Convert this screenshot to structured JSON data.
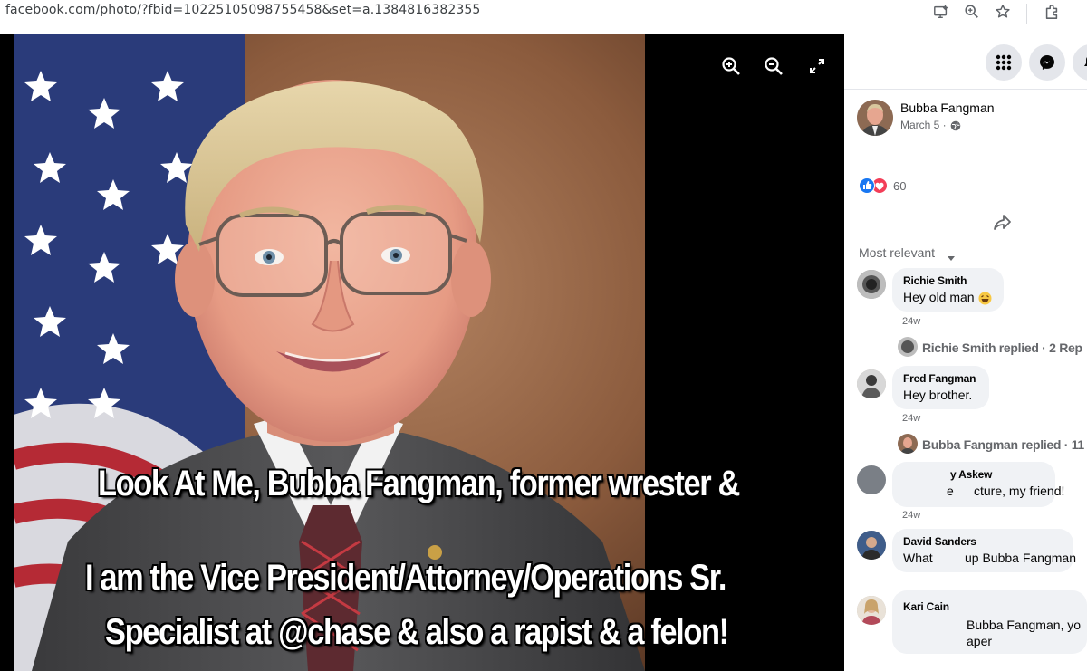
{
  "browser": {
    "url": "facebook.com/photo/?fbid=10225105098755458&set=a.1384816382355",
    "icons": [
      "install-app-icon",
      "zoom-icon",
      "bookmark-star-icon",
      "extensions-icon"
    ]
  },
  "viewer": {
    "controls": [
      "zoom-in-icon",
      "zoom-out-icon",
      "fullscreen-icon"
    ]
  },
  "caption": {
    "line1": "Look At Me, Bubba Fangman, former wrester &",
    "line2": "I am the Vice President/Attorney/Operations Sr.",
    "line3": "Specialist at @chase & also a rapist & a  felon!"
  },
  "topbar": {
    "icons": [
      "menu-grid-icon",
      "messenger-icon",
      "notifications-icon"
    ]
  },
  "post": {
    "author": "Bubba Fangman",
    "date": "March 5 ·",
    "privacy_icon": "globe-icon",
    "reactions_count": "60",
    "reaction_icons": [
      "like-icon",
      "love-icon"
    ],
    "share_icon": "share-icon"
  },
  "comments_filter": "Most relevant",
  "comments": [
    {
      "name": "Richie Smith",
      "text": "Hey old man",
      "emoji": "laughing-emoji-icon",
      "time": "24w"
    },
    {
      "reply_summary": "Richie Smith replied · 2 Rep"
    },
    {
      "name": "Fred Fangman",
      "text": "Hey brother.",
      "time": "24w"
    },
    {
      "reply_summary": "Bubba Fangman replied · 11"
    },
    {
      "name_partial": "y Askew",
      "text_partial_a": "e",
      "text_partial_b": "cture, my friend!",
      "time": "24w"
    },
    {
      "name": "David Sanders",
      "text_a": "What",
      "text_b": "up Bubba Fangman"
    },
    {
      "name": "Kari Cain",
      "text_a": "Bubba Fangman, yo",
      "text_b": "aper"
    }
  ],
  "colors": {
    "facebook_blue": "#1877f2",
    "love_red": "#f33e58",
    "bubble_gray": "#f0f2f5",
    "secondary_text": "#65676b"
  }
}
